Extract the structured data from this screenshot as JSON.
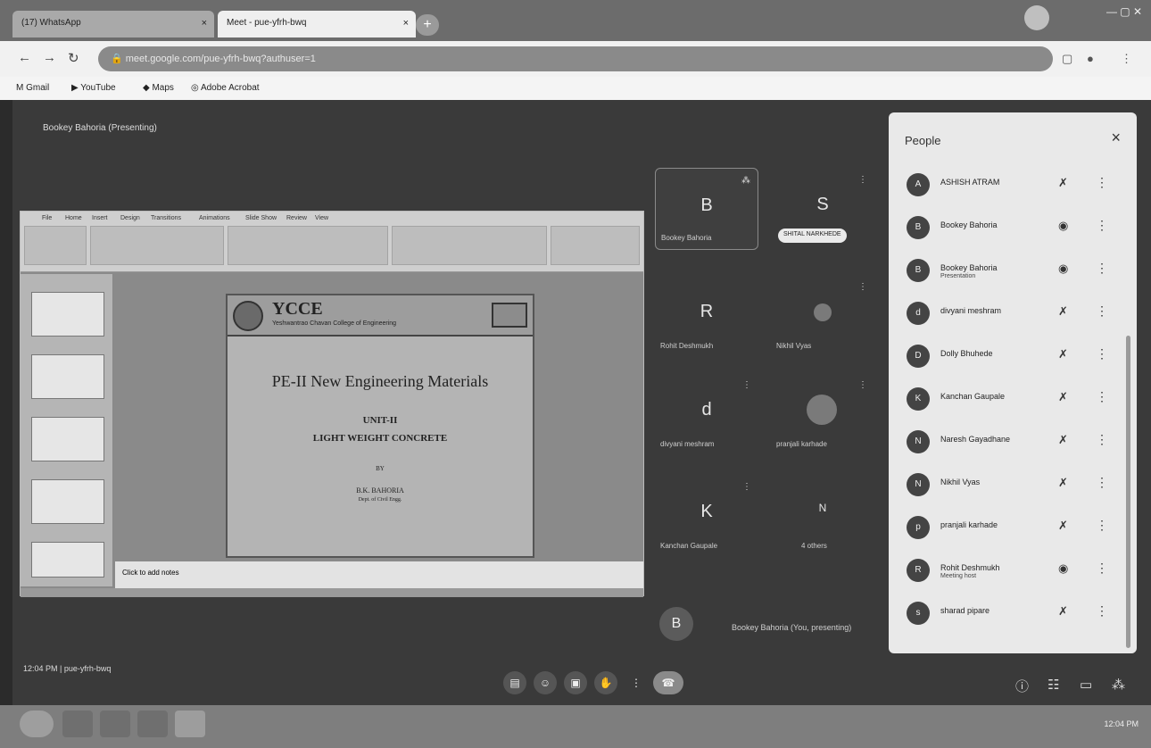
{
  "browser": {
    "tabs": [
      {
        "label": "(17) WhatsApp",
        "close": "×"
      },
      {
        "label": "Meet - pue-yfrh-bwq",
        "close": "×"
      }
    ],
    "new_tab": "+",
    "url": "meet.google.com/pue-yfrh-bwq?authuser=1",
    "window_controls": "—  ▢  ✕"
  },
  "bookmarks": [
    "Gmail",
    "YouTube",
    "Maps",
    "Adobe Acrobat"
  ],
  "meet": {
    "presenter_label": "Bookey Bahoria (Presenting)",
    "meeting_code": "12:04 PM | pue-yfrh-bwq",
    "self_tile_label": "Bookey Bahoria (You, presenting)",
    "self_initial": "B"
  },
  "presentation": {
    "ribbon_tabs": [
      "File",
      "Home",
      "Insert",
      "Design",
      "Transitions",
      "Animations",
      "Slide Show",
      "Review",
      "View"
    ],
    "slide": {
      "brand": "YCCE",
      "college": "Yeshwantrao Chavan College of Engineering",
      "title": "PE-II New Engineering Materials",
      "unit": "UNIT-II",
      "topic": "LIGHT WEIGHT CONCRETE",
      "by": "BY",
      "author": "B.K. BAHORIA",
      "dept": "Dept. of Civil Engg."
    },
    "notes_placeholder": "Click to add notes"
  },
  "tiles": [
    {
      "initial": "B",
      "name": "Bookey Bahoria"
    },
    {
      "initial": "S",
      "name": "SHITAL NARKHEDE"
    },
    {
      "initial": "R",
      "name": "Rohit Deshmukh"
    },
    {
      "initial": "",
      "name": "Nikhil Vyas"
    },
    {
      "initial": "d",
      "name": "divyani meshram"
    },
    {
      "initial": "",
      "name": "pranjali karhade"
    },
    {
      "initial": "K",
      "name": "Kanchan Gaupale"
    },
    {
      "initial": "N",
      "name": "4 others"
    }
  ],
  "people": {
    "title": "People",
    "close": "×",
    "list": [
      {
        "initial": "A",
        "name": "ASHISH ATRAM",
        "sub": "",
        "status": "mic-off"
      },
      {
        "initial": "B",
        "name": "Bookey Bahoria",
        "sub": "",
        "status": "speaking"
      },
      {
        "initial": "B",
        "name": "Bookey Bahoria",
        "sub": "Presentation",
        "status": "present"
      },
      {
        "initial": "d",
        "name": "divyani meshram",
        "sub": "",
        "status": "mic-off"
      },
      {
        "initial": "D",
        "name": "Dolly Bhuhede",
        "sub": "",
        "status": "mic-off"
      },
      {
        "initial": "K",
        "name": "Kanchan Gaupale",
        "sub": "",
        "status": "mic-off"
      },
      {
        "initial": "N",
        "name": "Naresh Gayadhane",
        "sub": "",
        "status": "mic-off"
      },
      {
        "initial": "N",
        "name": "Nikhil Vyas",
        "sub": "",
        "status": "mic-off"
      },
      {
        "initial": "p",
        "name": "pranjali karhade",
        "sub": "",
        "status": "mic-off"
      },
      {
        "initial": "R",
        "name": "Rohit Deshmukh",
        "sub": "Meeting host",
        "status": "speaking"
      },
      {
        "initial": "s",
        "name": "sharad pipare",
        "sub": "",
        "status": "mic-off"
      }
    ]
  },
  "taskbar": {
    "tray_time": "12:04 PM"
  },
  "icons": {
    "mic_off": "🎙",
    "more": "⋮",
    "mic_on": "◉"
  }
}
